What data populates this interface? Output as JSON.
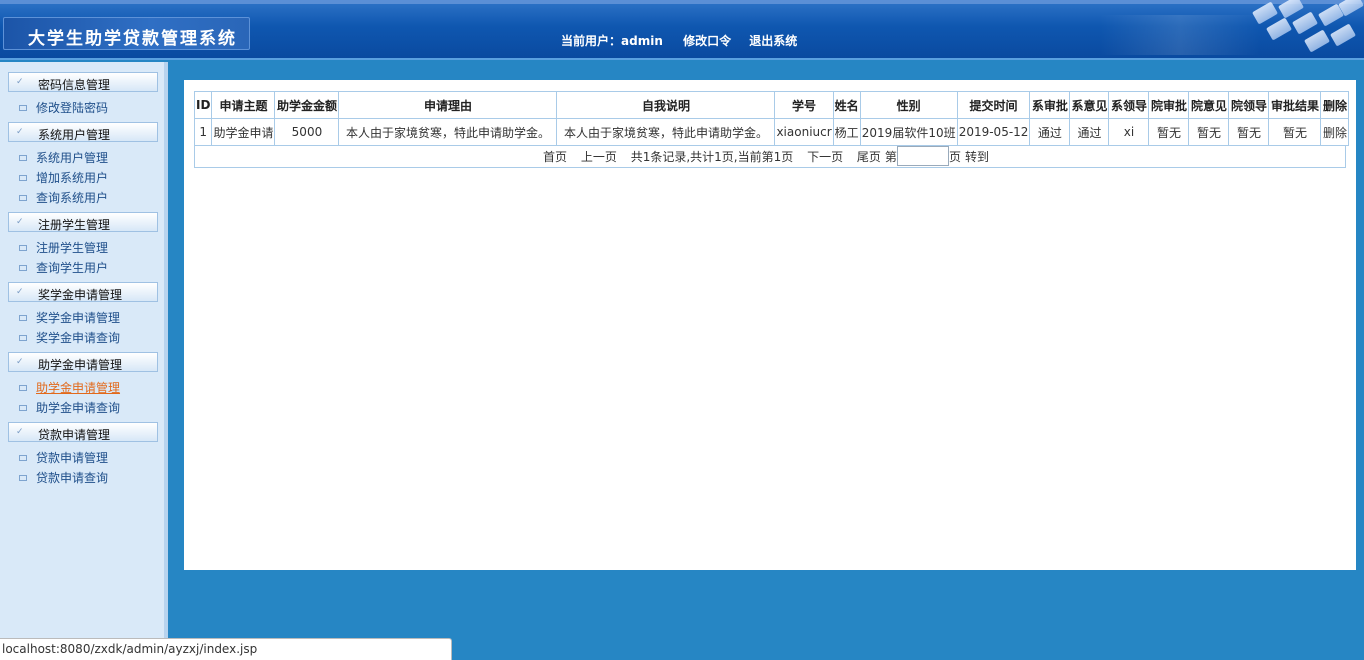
{
  "header": {
    "app_title": "大学生助学贷款管理系统",
    "current_user_label": "当前用户：",
    "current_user": "admin",
    "change_password": "修改口令",
    "logout": "退出系统"
  },
  "sidebar": {
    "groups": [
      {
        "label": "密码信息管理",
        "items": [
          {
            "label": "修改登陆密码"
          }
        ]
      },
      {
        "label": "系统用户管理",
        "items": [
          {
            "label": "系统用户管理"
          },
          {
            "label": "增加系统用户"
          },
          {
            "label": "查询系统用户"
          }
        ]
      },
      {
        "label": "注册学生管理",
        "items": [
          {
            "label": "注册学生管理"
          },
          {
            "label": "查询学生用户"
          }
        ]
      },
      {
        "label": "奖学金申请管理",
        "items": [
          {
            "label": "奖学金申请管理"
          },
          {
            "label": "奖学金申请查询"
          }
        ]
      },
      {
        "label": "助学金申请管理",
        "items": [
          {
            "label": "助学金申请管理"
          },
          {
            "label": "助学金申请查询"
          }
        ]
      },
      {
        "label": "贷款申请管理",
        "items": [
          {
            "label": "贷款申请管理"
          },
          {
            "label": "贷款申请查询"
          }
        ]
      }
    ],
    "active_item": "助学金申请管理"
  },
  "table": {
    "columns": [
      "ID",
      "申请主题",
      "助学金金额",
      "申请理由",
      "自我说明",
      "学号",
      "姓名",
      "性别",
      "提交时间",
      "系审批",
      "系意见",
      "系领导",
      "院审批",
      "院意见",
      "院领导",
      "审批结果",
      "删除"
    ],
    "rows": [
      [
        "1",
        "助学金申请",
        "5000",
        "本人由于家境贫寒，特此申请助学金。",
        "本人由于家境贫寒，特此申请助学金。",
        "xiaoniucr",
        "杨工",
        "2019届软件10班",
        "2019-05-12",
        "通过",
        "通过",
        "xi",
        "暂无",
        "暂无",
        "暂无",
        "暂无",
        "删除"
      ]
    ]
  },
  "pager": {
    "first": "首页",
    "prev": "上一页",
    "summary": "共1条记录,共计1页,当前第1页",
    "next": "下一页",
    "last": "尾页",
    "goto_prefix": "第",
    "goto_input_value": "",
    "goto_suffix": "页",
    "goto_button": "转到"
  },
  "statusbar": {
    "url": "localhost:8080/zxdk/admin/ayzxj/index.jsp"
  }
}
